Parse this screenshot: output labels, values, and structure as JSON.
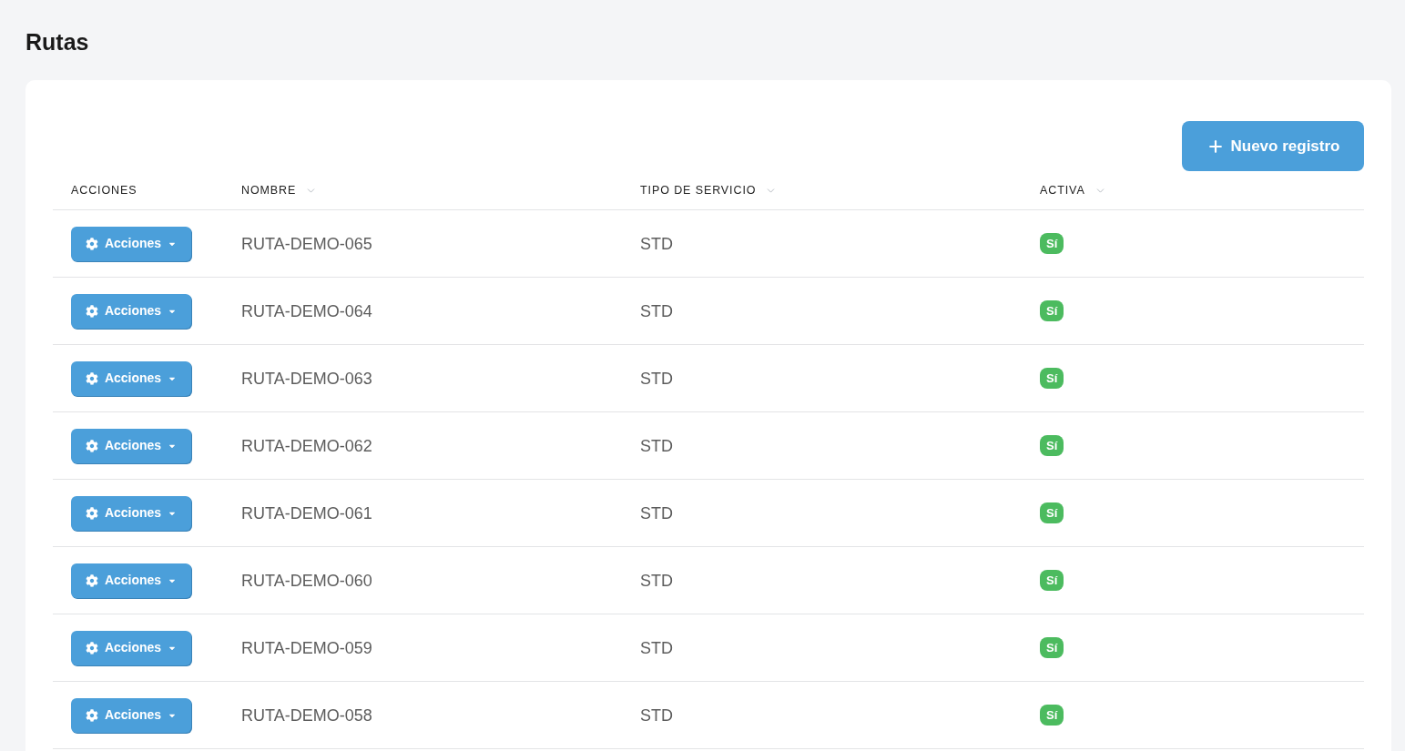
{
  "page": {
    "title": "Rutas"
  },
  "toolbar": {
    "new_button": {
      "label": "Nuevo registro"
    }
  },
  "table": {
    "columns": [
      {
        "label": "ACCIONES",
        "sortable": false
      },
      {
        "label": "NOMBRE",
        "sortable": true
      },
      {
        "label": "TIPO DE SERVICIO",
        "sortable": true
      },
      {
        "label": "ACTIVA",
        "sortable": true
      }
    ],
    "rows": [
      {
        "actions_button": "Acciones",
        "nombre": "RUTA-DEMO-065",
        "tipo_de_servicio": "STD",
        "activa": "Sí"
      },
      {
        "actions_button": "Acciones",
        "nombre": "RUTA-DEMO-064",
        "tipo_de_servicio": "STD",
        "activa": "Sí"
      },
      {
        "actions_button": "Acciones",
        "nombre": "RUTA-DEMO-063",
        "tipo_de_servicio": "STD",
        "activa": "Sí"
      },
      {
        "actions_button": "Acciones",
        "nombre": "RUTA-DEMO-062",
        "tipo_de_servicio": "STD",
        "activa": "Sí"
      },
      {
        "actions_button": "Acciones",
        "nombre": "RUTA-DEMO-061",
        "tipo_de_servicio": "STD",
        "activa": "Sí"
      },
      {
        "actions_button": "Acciones",
        "nombre": "RUTA-DEMO-060",
        "tipo_de_servicio": "STD",
        "activa": "Sí"
      },
      {
        "actions_button": "Acciones",
        "nombre": "RUTA-DEMO-059",
        "tipo_de_servicio": "STD",
        "activa": "Sí"
      },
      {
        "actions_button": "Acciones",
        "nombre": "RUTA-DEMO-058",
        "tipo_de_servicio": "STD",
        "activa": "Sí"
      }
    ]
  }
}
